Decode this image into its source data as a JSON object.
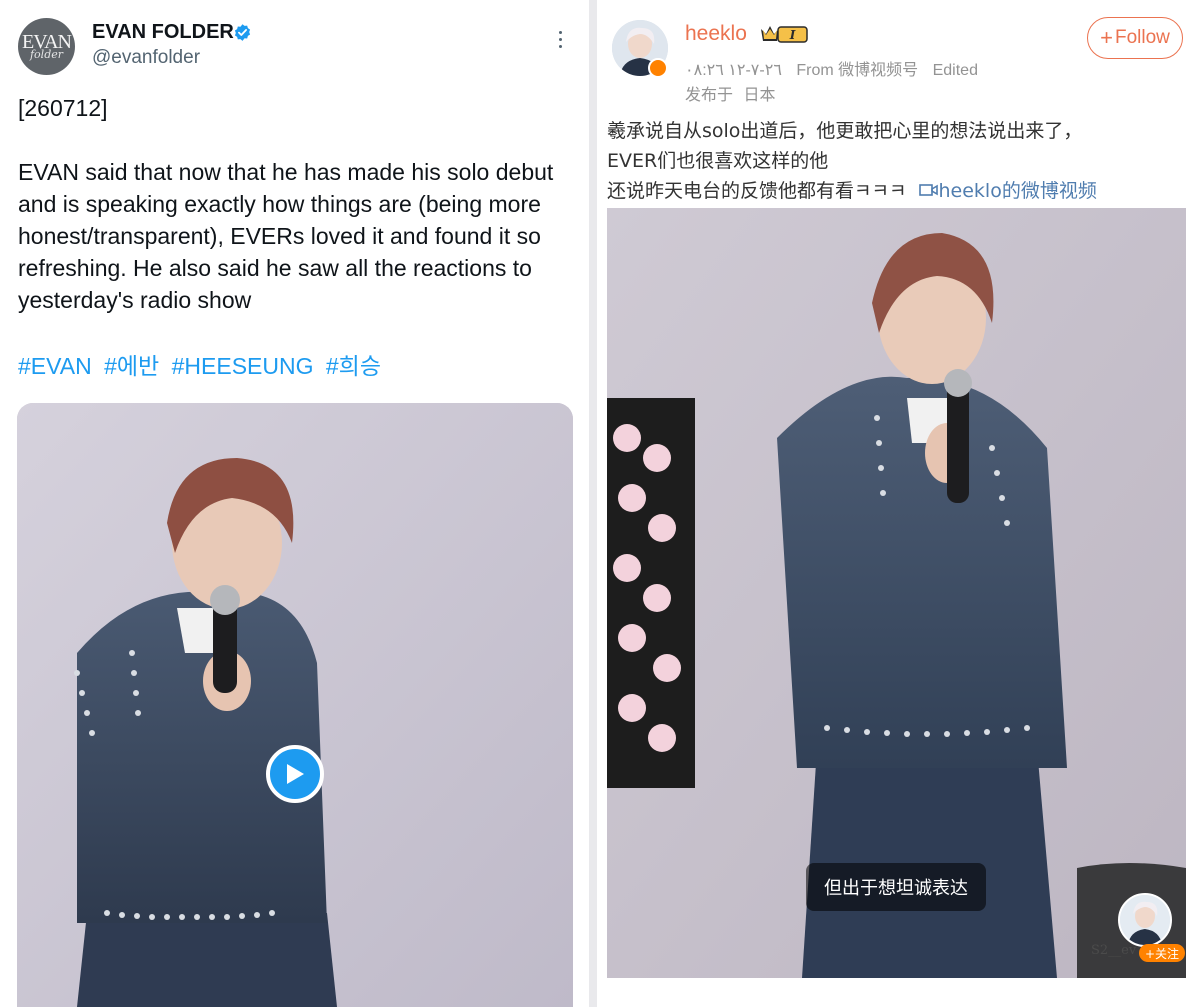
{
  "left_post": {
    "avatar_text_top": "EVAN",
    "avatar_text_bottom": "folder",
    "display_name": "EVAN FOLDER",
    "handle": "@evanfolder",
    "date_tag": "[260712]",
    "body": "EVAN said that now that he has made his solo debut and is speaking exactly how things are (being more honest/transparent), EVERs loved it and found it so refreshing. He also said he saw all the reactions to yesterday's radio show",
    "hashtags": [
      "#EVAN",
      "#에반",
      "#HEESEUNG",
      "#희승"
    ],
    "colors": {
      "link": "#1d9bf0",
      "verified": "#1d9bf0"
    },
    "icons": [
      "verified-badge-icon",
      "more-options-icon",
      "play-icon"
    ]
  },
  "right_post": {
    "username": "heeklo",
    "level_badge": "I",
    "timestamp": "٢٦-٧-١٢ ٠٨:٢٦",
    "source": "From 微博视频号",
    "edited": "Edited",
    "location_prefix": "发布于",
    "location": "日本",
    "follow_label": "Follow",
    "text_line1": "羲承说自从solo出道后，他更敢把心里的想法说出来了，",
    "text_line2": "EVER们也很喜欢这样的他",
    "text_line3": "还说昨天电台的反馈他都有看ㅋㅋㅋ",
    "video_link_label": "heeklo的微博视频",
    "video_subtitle": "但出于想坦诚表达",
    "mini_follow_label": "+关注",
    "watermark": "S2__ev",
    "colors": {
      "username": "#eb7350",
      "link": "#507daf",
      "follow": "#ff8200"
    },
    "icons": [
      "crown-level-icon",
      "video-link-icon",
      "verified-v-icon"
    ]
  }
}
